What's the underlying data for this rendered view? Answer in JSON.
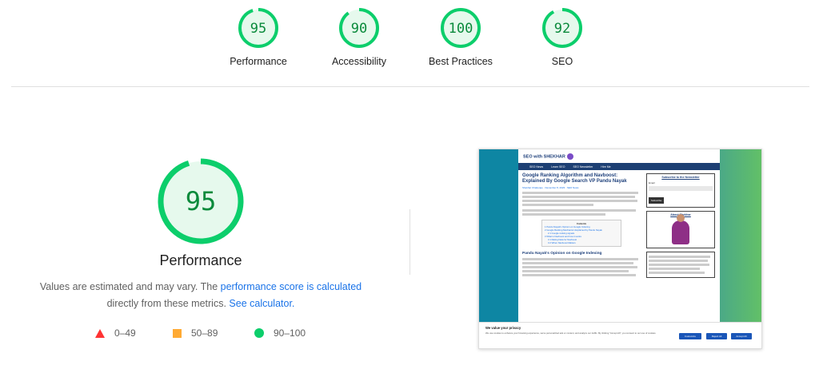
{
  "summary": {
    "gauges": [
      {
        "label": "Performance",
        "score": "95",
        "value": 0.95
      },
      {
        "label": "Accessibility",
        "score": "90",
        "value": 0.9
      },
      {
        "label": "Best Practices",
        "score": "100",
        "value": 1.0
      },
      {
        "label": "SEO",
        "score": "92",
        "value": 0.92
      }
    ]
  },
  "performance": {
    "score": "95",
    "value": 0.95,
    "title": "Performance",
    "desc_prefix": "Values are estimated and may vary. The ",
    "desc_link": "performance score is calculated",
    "desc_middle": " directly from these metrics. ",
    "desc_link2": "See calculator.",
    "legend": [
      {
        "range": "0–49",
        "icon": "fail-triangle-icon",
        "color": "#ff3333"
      },
      {
        "range": "50–89",
        "icon": "average-square-icon",
        "color": "#ffaa33"
      },
      {
        "range": "90–100",
        "icon": "pass-circle-icon",
        "color": "#0cce6b"
      }
    ]
  },
  "colors": {
    "pass": "#0cce6b",
    "pass_text": "#0a8a3b",
    "pass_bg": "#e6f9ed",
    "link": "#1a73e8"
  },
  "thumbnail": {
    "logo": "SEO with SHEKHAR",
    "nav": [
      "SEO News",
      "Learn SEO",
      "SEO Newsletter",
      "Hire Me"
    ],
    "article_title": "Google Ranking Algorithm and Navboost: Explained By Google Search VP Pandu Nayak",
    "article_meta": "Shekhar Chatterjee · December 8, 2023 · SEO News",
    "toc_title": "Contents",
    "toc_items": [
      "1 Pandu Nayak's Opinion on Google Indexing",
      "2 Google Ranking Mechanism Explained by Pandu Nayak",
      "2.1 Google ranking signals",
      "3 What is Navboost and how it works",
      "3.1 Rating Data for Navboost",
      "3.2 When Navboost Matters"
    ],
    "section_heading": "Pandu Nayak's Opinion on Google Indexing",
    "sidebar_newsletter": "Subscribe to the Newsletter",
    "email_label": "Email",
    "subscribe_btn": "Subscribe",
    "about_title": "About Shekhar",
    "cookie_title": "We value your privacy",
    "cookie_text": "We use cookies to enhance your browsing experience, serve personalized ads or content, and analyze our traffic. By clicking \"Accept All\", you consent to our use of cookies.",
    "cookie_buttons": [
      "Customize",
      "Reject All",
      "Accept All"
    ]
  }
}
